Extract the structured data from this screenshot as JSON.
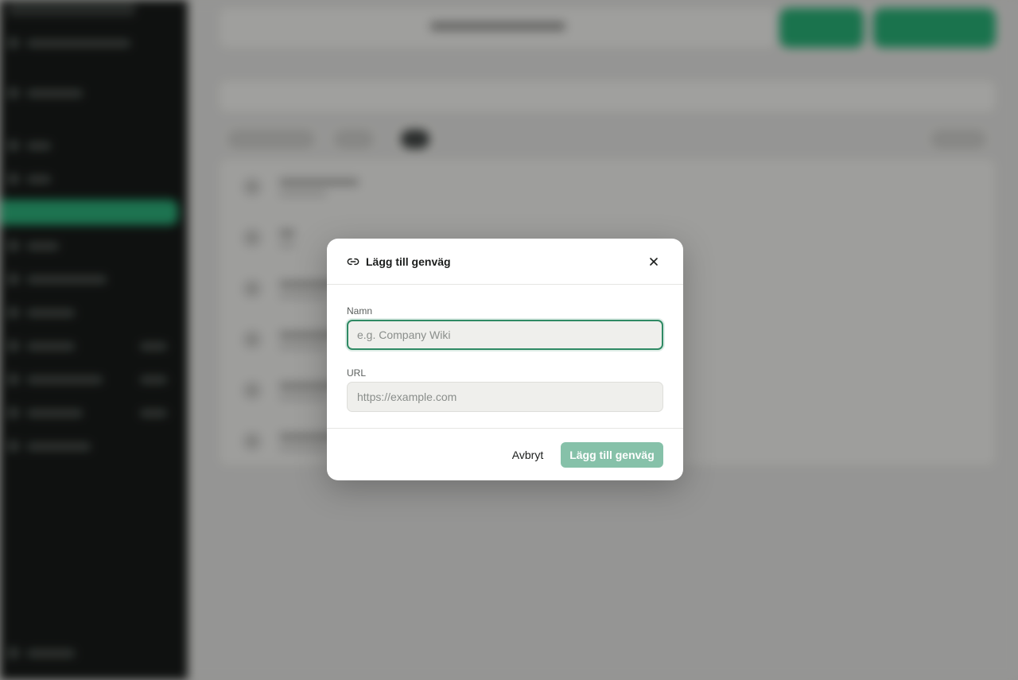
{
  "dialog": {
    "title": "Lägg till genväg",
    "title_icon": "link-icon",
    "close_icon": "close-icon",
    "fields": {
      "name": {
        "label": "Namn",
        "value": "",
        "placeholder": "e.g. Company Wiki",
        "focused": true
      },
      "url": {
        "label": "URL",
        "value": "",
        "placeholder": "https://example.com"
      }
    },
    "buttons": {
      "cancel": "Avbryt",
      "submit": "Lägg till genväg"
    }
  },
  "colors": {
    "accent": "#2f8a64",
    "submit_disabled": "#86c1a9",
    "sidebar_bg": "#101211",
    "sidebar_active": "#1f7a55"
  }
}
